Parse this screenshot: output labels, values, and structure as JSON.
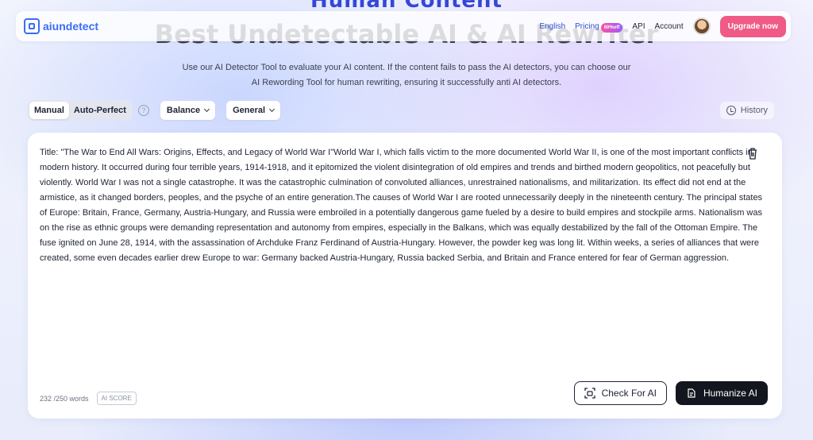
{
  "hero": {
    "top_heading": "Human Content",
    "main_heading": "Best Undetectable AI & AI Rewriter"
  },
  "nav": {
    "logo_text": "aiundetect",
    "links": [
      "English",
      "Pricing",
      "API",
      "Account"
    ],
    "pricing_badge": "60%off",
    "upgrade_label": "Upgrade now"
  },
  "description": {
    "line1": "Use our AI Detector Tool to evaluate your AI content. If the content fails to pass the AI detectors, you can choose our",
    "line2": "AI Rewording Tool for human rewriting, ensuring it successfully anti AI detectors."
  },
  "toolbar": {
    "mode_manual": "Manual",
    "mode_auto": "Auto-Perfect",
    "help": "?",
    "dropdown_1": "Balance",
    "dropdown_2": "General",
    "history": "History"
  },
  "editor": {
    "text": "Title: \"The War to End All Wars: Origins, Effects, and Legacy of World War I\"World War I, which falls victim to the more documented World War II, is one of the most important conflicts in modern history. It occurred during four terrible years, 1914-1918, and it epitomized the violent disintegration of old empires and trends and birthed modern geopolitics, not peacefully but violently. World War I was not a single catastrophe. It was the catastrophic culmination of convoluted alliances, unrestrained nationalisms, and militarization. Its effect did not end at the armistice, as it changed borders, peoples, and the psyche of an entire generation.The causes of World War I are rooted unnecessarily deeply in the nineteenth century. The principal states of Europe: Britain, France, Germany, Austria-Hungary, and Russia were embroiled in a potentially dangerous game fueled by a desire to build empires and stockpile arms. Nationalism was on the rise as ethnic groups were demanding representation and autonomy from empires, especially in the Balkans, which was equally destabilized by the fall of the Ottoman Empire. The fuse ignited on June 28, 1914, with the assassination of Archduke Franz Ferdinand of Austria-Hungary. However, the powder keg was long lit. Within weeks, a series of alliances that were created, some even decades earlier drew Europe to war: Germany backed Austria-Hungary, Russia backed Serbia, and Britain and France entered for fear of German aggression.",
    "word_count": "232 /250 words",
    "ai_score_label": "AI SCORE",
    "check_label": "Check For AI",
    "humanize_label": "Humanize AI"
  },
  "colors": {
    "brand": "#3b6ef5",
    "upgrade": "#ef5a86",
    "dark_button": "#14161f"
  }
}
